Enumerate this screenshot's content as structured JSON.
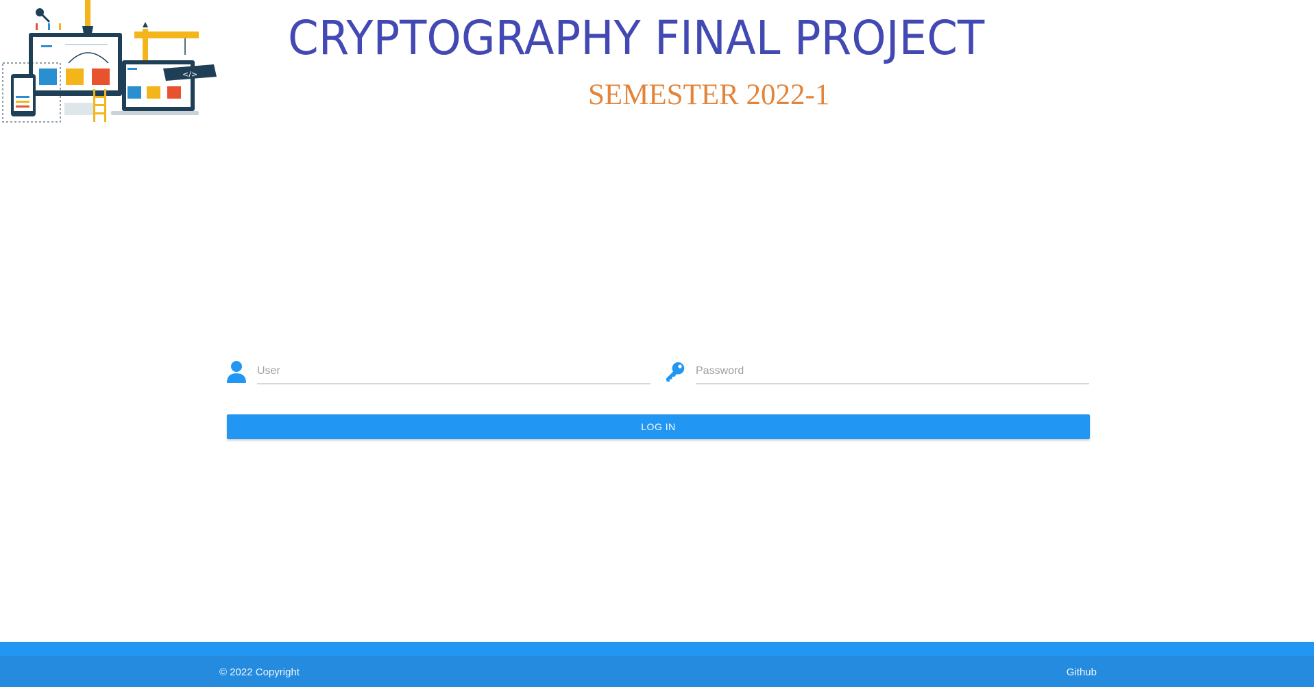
{
  "header": {
    "title": "CRYPTOGRAPHY FINAL PROJECT",
    "subtitle": "SEMESTER 2022-1"
  },
  "login": {
    "user_placeholder": "User",
    "password_placeholder": "Password",
    "button_label": "LOG IN",
    "user_icon": "user-icon",
    "password_icon": "key-icon"
  },
  "footer": {
    "copyright": "© 2022 Copyright",
    "github_label": "Github"
  },
  "colors": {
    "title": "#4349b3",
    "subtitle": "#e2843a",
    "accent": "#2196f3",
    "footer": "#248bde"
  }
}
